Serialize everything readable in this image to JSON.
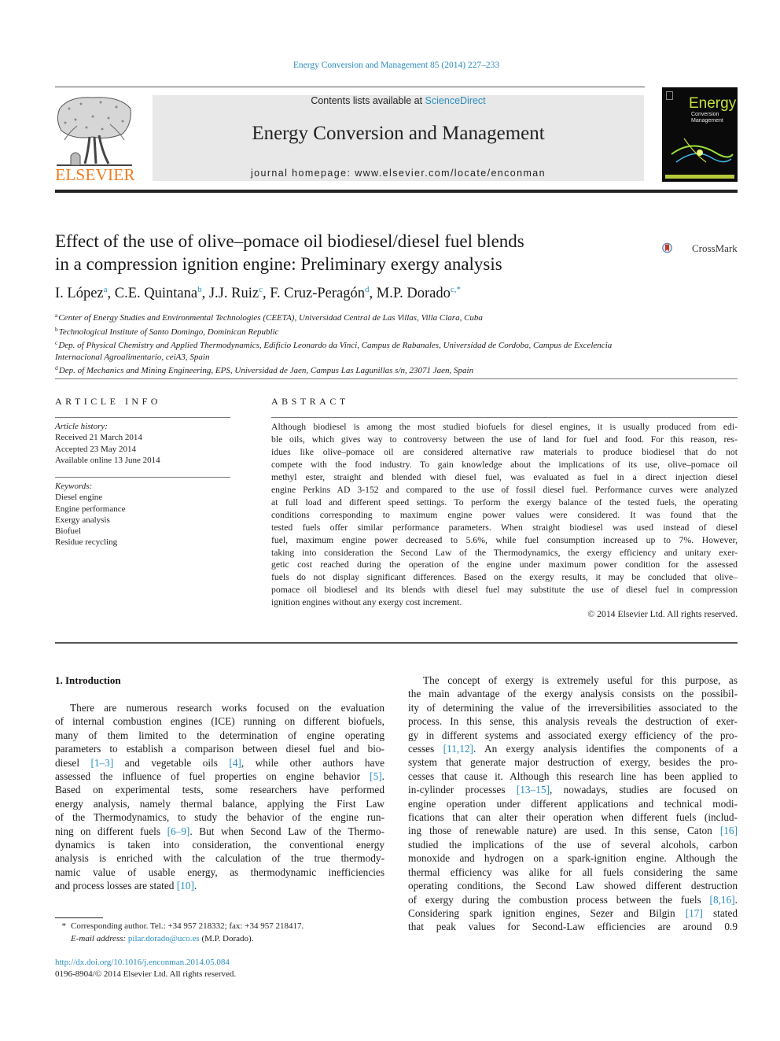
{
  "header": {
    "journal_ref": "Energy Conversion and Management 85 (2014) 227–233",
    "contents_prefix": "Contents lists available at ",
    "contents_link": "ScienceDirect",
    "journal_title": "Energy Conversion and Management",
    "homepage_label": "journal homepage: ",
    "homepage_url": "www.elsevier.com/locate/enconman",
    "publisher": "ELSEVIER",
    "cover": {
      "title_main": "Energy",
      "title_sub1": "Conversion",
      "title_sub2": "Management"
    },
    "crossmark": "CrossMark"
  },
  "article": {
    "title_line1": "Effect of the use of olive–pomace oil biodiesel/diesel fuel blends",
    "title_line2": "in a compression ignition engine: Preliminary exergy analysis",
    "authors": [
      {
        "name": "I. López",
        "sup": "a",
        "sep": ", "
      },
      {
        "name": "C.E. Quintana",
        "sup": "b",
        "sep": ", "
      },
      {
        "name": "J.J. Ruiz",
        "sup": "c",
        "sep": ", "
      },
      {
        "name": "F. Cruz-Peragón",
        "sup": "d",
        "sep": ", "
      },
      {
        "name": "M.P. Dorado",
        "sup": "c,*",
        "sep": ""
      }
    ],
    "affiliations": [
      {
        "key": "a",
        "text": "Center of Energy Studies and Environmental Technologies (CEETA), Universidad Central de Las Villas, Villa Clara, Cuba"
      },
      {
        "key": "b",
        "text": "Technological Institute of Santo Domingo, Dominican Republic"
      },
      {
        "key": "c",
        "text": "Dep. of Physical Chemistry and Applied Thermodynamics, Edificio Leonardo da Vinci, Campus de Rabanales, Universidad de Cordoba, Campus de Excelencia Internacional Agroalimentario, ceiA3, Spain"
      },
      {
        "key": "d",
        "text": "Dep. of Mechanics and Mining Engineering, EPS, Universidad de Jaen, Campus Las Lagunillas s/n, 23071 Jaen, Spain"
      }
    ]
  },
  "article_info": {
    "heading": "ARTICLE INFO",
    "history_label": "Article history:",
    "history": [
      "Received 21 March 2014",
      "Accepted 23 May 2014",
      "Available online 13 June 2014"
    ],
    "keywords_label": "Keywords:",
    "keywords": [
      "Diesel engine",
      "Engine performance",
      "Exergy analysis",
      "Biofuel",
      "Residue recycling"
    ]
  },
  "abstract": {
    "heading": "ABSTRACT",
    "lines": [
      "Although biodiesel is among the most studied biofuels for diesel engines, it is usually produced from edi-",
      "ble oils, which gives way to controversy between the use of land for fuel and food. For this reason, res-",
      "idues like olive–pomace oil are considered alternative raw materials to produce biodiesel that do not",
      "compete with the food industry. To gain knowledge about the implications of its use, olive–pomace oil",
      "methyl ester, straight and blended with diesel fuel, was evaluated as fuel in a direct injection diesel",
      "engine Perkins AD 3-152 and compared to the use of fossil diesel fuel. Performance curves were analyzed",
      "at full load and different speed settings. To perform the exergy balance of the tested fuels, the operating",
      "conditions corresponding to maximum engine power values were considered. It was found that the",
      "tested fuels offer similar performance parameters. When straight biodiesel was used instead of diesel",
      "fuel, maximum engine power decreased to 5.6%, while fuel consumption increased up to 7%. However,",
      "taking into consideration the Second Law of the Thermodynamics, the exergy efficiency and unitary exer-",
      "getic cost reached during the operation of the engine under maximum power condition for the assessed",
      "fuels do not display significant differences. Based on the exergy results, it may be concluded that olive–",
      "pomace oil biodiesel and its blends with diesel fuel may substitute the use of diesel fuel in compression",
      "ignition engines without any exergy cost increment."
    ],
    "copyright": "© 2014 Elsevier Ltd. All rights reserved."
  },
  "introduction": {
    "heading": "1. Introduction",
    "left_lines": [
      [
        {
          "t": "There are numerous research works focused on the evaluation"
        }
      ],
      [
        {
          "t": "of internal combustion engines (ICE) running on different biofuels,"
        }
      ],
      [
        {
          "t": "many of them limited to the determination of engine operating"
        }
      ],
      [
        {
          "t": "parameters to establish a comparison between diesel fuel and bio-"
        }
      ],
      [
        {
          "t": "diesel "
        },
        {
          "ref": "[1–3]"
        },
        {
          "t": " and vegetable oils "
        },
        {
          "ref": "[4]"
        },
        {
          "t": ", while other authors have"
        }
      ],
      [
        {
          "t": "assessed the influence of fuel properties on engine behavior "
        },
        {
          "ref": "[5]"
        },
        {
          "t": "."
        }
      ],
      [
        {
          "t": "Based on experimental tests, some researchers have performed"
        }
      ],
      [
        {
          "t": "energy analysis, namely thermal balance, applying the First Law"
        }
      ],
      [
        {
          "t": "of the Thermodynamics, to study the behavior of the engine run-"
        }
      ],
      [
        {
          "t": "ning on different fuels "
        },
        {
          "ref": "[6–9]"
        },
        {
          "t": ". But when Second Law of the Thermo-"
        }
      ],
      [
        {
          "t": "dynamics is taken into consideration, the conventional energy"
        }
      ],
      [
        {
          "t": "analysis is enriched with the calculation of the true thermody-"
        }
      ],
      [
        {
          "t": "namic value of usable energy, as thermodynamic inefficiencies"
        }
      ],
      [
        {
          "t": "and process losses are stated "
        },
        {
          "ref": "[10]"
        },
        {
          "t": "."
        }
      ]
    ],
    "right_lines": [
      [
        {
          "t": "The concept of exergy is extremely useful for this purpose, as"
        }
      ],
      [
        {
          "t": "the main advantage of the exergy analysis consists on the possibil-"
        }
      ],
      [
        {
          "t": "ity of determining the value of the irreversibilities associated to the"
        }
      ],
      [
        {
          "t": "process. In this sense, this analysis reveals the destruction of exer-"
        }
      ],
      [
        {
          "t": "gy in different systems and associated exergy efficiency of the pro-"
        }
      ],
      [
        {
          "t": "cesses "
        },
        {
          "ref": "[11,12]"
        },
        {
          "t": ". An exergy analysis identifies the components of a"
        }
      ],
      [
        {
          "t": "system that generate major destruction of exergy, besides the pro-"
        }
      ],
      [
        {
          "t": "cesses that cause it. Although this research line has been applied to"
        }
      ],
      [
        {
          "t": "in-cylinder processes "
        },
        {
          "ref": "[13–15]"
        },
        {
          "t": ", nowadays, studies are focused on"
        }
      ],
      [
        {
          "t": "engine operation under different applications and technical modi-"
        }
      ],
      [
        {
          "t": "fications that can alter their operation when different fuels (includ-"
        }
      ],
      [
        {
          "t": "ing those of renewable nature) are used. In this sense, Caton "
        },
        {
          "ref": "[16]"
        }
      ],
      [
        {
          "t": "studied the implications of the use of several alcohols, carbon"
        }
      ],
      [
        {
          "t": "monoxide and hydrogen on a spark-ignition engine. Although the"
        }
      ],
      [
        {
          "t": "thermal efficiency was alike for all fuels considering the same"
        }
      ],
      [
        {
          "t": "operating conditions, the Second Law showed different destruction"
        }
      ],
      [
        {
          "t": "of exergy during the combustion process between the fuels "
        },
        {
          "ref": "[8,16]"
        },
        {
          "t": "."
        }
      ],
      [
        {
          "t": "Considering spark ignition engines, Sezer and Bilgin "
        },
        {
          "ref": "[17]"
        },
        {
          "t": " stated"
        }
      ],
      [
        {
          "t": "that peak values for Second-Law efficiencies are around 0.9"
        }
      ]
    ]
  },
  "footnote": {
    "marker": "*",
    "corresponding": "Corresponding author. Tel.: +34 957 218332; fax: +34 957 218417.",
    "email_label": "E-mail address: ",
    "email": "pilar.dorado@uco.es",
    "email_suffix": " (M.P. Dorado)."
  },
  "doi": {
    "url": "http://dx.doi.org/10.1016/j.enconman.2014.05.084",
    "issn_line": "0196-8904/© 2014 Elsevier Ltd. All rights reserved."
  }
}
